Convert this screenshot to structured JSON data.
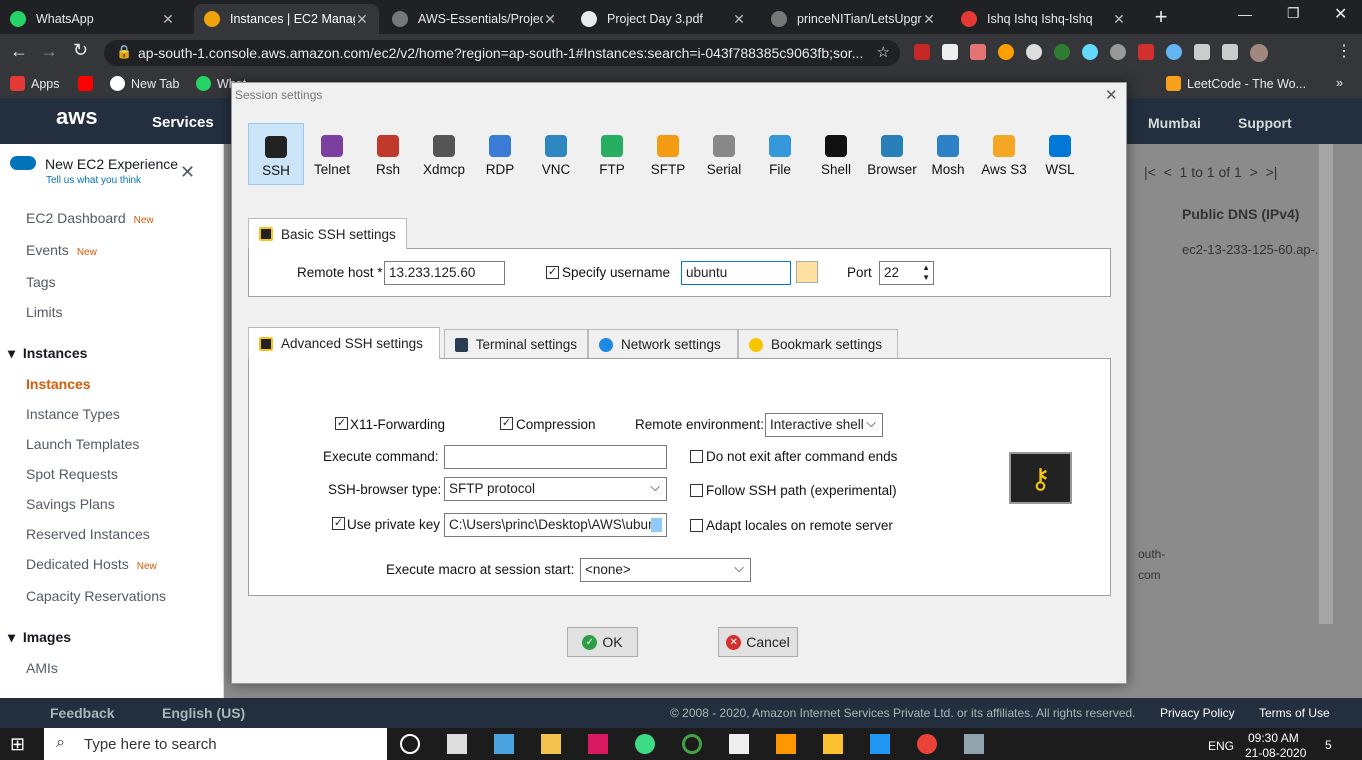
{
  "browser": {
    "tabs": [
      {
        "title": "WhatsApp",
        "color": "#25d366"
      },
      {
        "title": "Instances | EC2 Manage",
        "color": "#f0a30a"
      },
      {
        "title": "AWS-Essentials/Project",
        "color": "#777777"
      },
      {
        "title": "Project Day 3.pdf",
        "color": "#e8eaed"
      },
      {
        "title": "princeNITian/LetsUpgra",
        "color": "#777777"
      },
      {
        "title": "Ishq Ishq Ishq-Ishq",
        "color": "#e53935"
      }
    ],
    "url": "ap-south-1.console.aws.amazon.com/ec2/v2/home?region=ap-south-1#Instances:search=i-043f788385c9063fb;sor...",
    "bookmarks": [
      "Apps",
      "",
      "New Tab",
      "What...",
      "LeetCode - The Wo..."
    ]
  },
  "aws": {
    "logo": "aws",
    "services": "Services",
    "region": "Mumbai",
    "support": "Support",
    "new_exp": "New EC2 Experience",
    "new_exp_sub": "Tell us what you think",
    "nav": {
      "dashboard": "EC2 Dashboard",
      "events": "Events",
      "new": "New",
      "tags": "Tags",
      "limits": "Limits",
      "instances_head": "Instances",
      "instances": "Instances",
      "types": "Instance Types",
      "templates": "Launch Templates",
      "spot": "Spot Requests",
      "savings": "Savings Plans",
      "reserved": "Reserved Instances",
      "dedicated": "Dedicated Hosts",
      "capacity": "Capacity Reservations",
      "images_head": "Images",
      "amis": "AMIs"
    },
    "pager": "1 to 1 of 1",
    "col_dns": "Public DNS (IPv4)",
    "dns_value": "ec2-13-233-125-60.ap-...",
    "south": "outh-",
    "com": "com",
    "footer": {
      "feedback": "Feedback",
      "language": "English (US)",
      "copyright": "© 2008 - 2020, Amazon Internet Services Private Ltd. or its affiliates. All rights reserved.",
      "privacy": "Privacy Policy",
      "terms": "Terms of Use"
    }
  },
  "dialog": {
    "title": "Session settings",
    "session_types": [
      {
        "label": "SSH",
        "color": "#222222"
      },
      {
        "label": "Telnet",
        "color": "#7b3fa0"
      },
      {
        "label": "Rsh",
        "color": "#c0392b"
      },
      {
        "label": "Xdmcp",
        "color": "#555555"
      },
      {
        "label": "RDP",
        "color": "#3a7bd5"
      },
      {
        "label": "VNC",
        "color": "#2e86c1"
      },
      {
        "label": "FTP",
        "color": "#27ae60"
      },
      {
        "label": "SFTP",
        "color": "#f39c12"
      },
      {
        "label": "Serial",
        "color": "#888888"
      },
      {
        "label": "File",
        "color": "#3498db"
      },
      {
        "label": "Shell",
        "color": "#111111"
      },
      {
        "label": "Browser",
        "color": "#2980b9"
      },
      {
        "label": "Mosh",
        "color": "#2c81c7"
      },
      {
        "label": "Aws S3",
        "color": "#f5a623"
      },
      {
        "label": "WSL",
        "color": "#0078d7"
      }
    ],
    "basic_tab": "Basic SSH settings",
    "remote_host_label": "Remote host *",
    "remote_host": "13.233.125.60",
    "specify_username": "Specify username",
    "username": "ubuntu",
    "port_label": "Port",
    "port": "22",
    "adv_tabs": [
      "Advanced SSH settings",
      "Terminal settings",
      "Network settings",
      "Bookmark settings"
    ],
    "x11": "X11-Forwarding",
    "compression": "Compression",
    "remote_env_label": "Remote environment:",
    "remote_env": "Interactive shell",
    "exec_cmd_label": "Execute command:",
    "exec_cmd": "",
    "no_exit": "Do not exit after command ends",
    "browser_type_label": "SSH-browser type:",
    "browser_type": "SFTP protocol",
    "follow_path": "Follow SSH path (experimental)",
    "use_key": "Use private key",
    "key_path": "C:\\Users\\princ\\Desktop\\AWS\\ubur",
    "adapt_locales": "Adapt locales on remote server",
    "macro_label": "Execute macro at session start:",
    "macro": "<none>",
    "ok": "OK",
    "cancel": "Cancel"
  },
  "taskbar": {
    "search": "Type here to search",
    "lang": "ENG",
    "time": "09:30 AM",
    "date": "21-08-2020",
    "notif": "5"
  }
}
